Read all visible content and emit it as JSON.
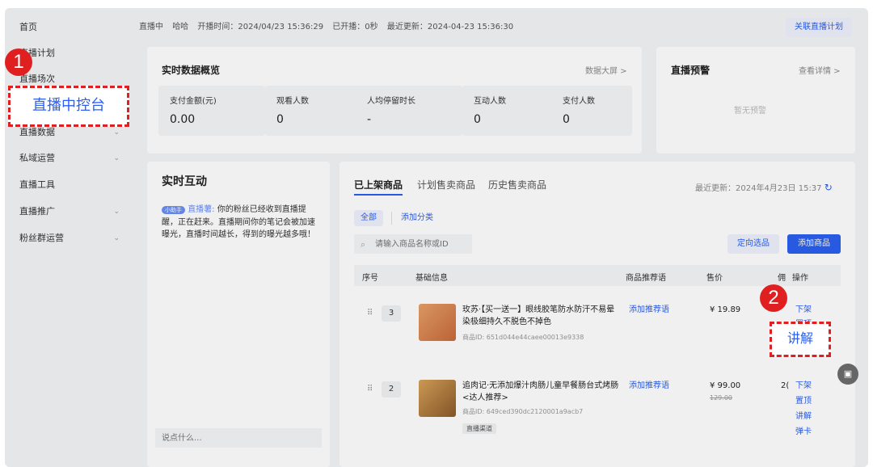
{
  "sidebar": {
    "items": [
      {
        "label": "首页"
      },
      {
        "label": "直播计划"
      },
      {
        "label": "直播场次"
      },
      {
        "label": "直播中控台"
      },
      {
        "label": "直播数据"
      },
      {
        "label": "私域运营"
      },
      {
        "label": "直播工具"
      },
      {
        "label": "直播推广"
      },
      {
        "label": "粉丝群运营"
      }
    ],
    "chevron": "⌄"
  },
  "topbar": {
    "status": "直播中",
    "host": "哈哈",
    "start_time": "开播时间：2024/04/23 15:36:29",
    "duration": "已开播：0秒",
    "updated": "最近更新：2024-04-23 15:36:30",
    "link_plan": "关联直播计划"
  },
  "overview": {
    "title": "实时数据概览",
    "big_screen": "数据大屏 >",
    "metrics": [
      {
        "label": "支付金额(元)",
        "value": "0.00"
      },
      {
        "label": "观看人数",
        "value": "0"
      },
      {
        "label": "人均停留时长",
        "value": "-"
      },
      {
        "label": "互动人数",
        "value": "0"
      },
      {
        "label": "支付人数",
        "value": "0"
      }
    ]
  },
  "warning": {
    "title": "直播预警",
    "details": "查看详情 >",
    "empty": "暂无预警"
  },
  "interaction": {
    "title": "实时互动",
    "badge": "小助手",
    "assistant_name": "直播薯:",
    "message": "你的粉丝已经收到直播提醒，正在赶来。直播期间你的笔记会被加速曝光，直播时间越长，得到的曝光越多哦！",
    "input_placeholder": "说点什么..."
  },
  "products": {
    "tabs": [
      "已上架商品",
      "计划售卖商品",
      "历史售卖商品"
    ],
    "updated": "最近更新：2024年4月23日 15:37",
    "refresh_icon": "↻",
    "filter_all": "全部",
    "add_category": "添加分类",
    "search_placeholder": "请输入商品名称或ID",
    "select_button": "定向选品",
    "add_button": "添加商品",
    "columns": {
      "index": "序号",
      "info": "基础信息",
      "slogan": "商品推荐语",
      "price": "售价",
      "commission": "佣",
      "actions": "操作"
    },
    "rows": [
      {
        "index": "3",
        "title": "玫苏·【买一送一】眼线胶笔防水防汗不易晕染极细持久不脱色不掉色",
        "id": "商品ID: 651d044e44caee00013e9338",
        "slogan": "添加推荐语",
        "price": "¥ 19.89",
        "actions": [
          "下架",
          "置顶"
        ]
      },
      {
        "index": "2",
        "title": "追肉记·无添加爆汁肉肠儿童早餐肠台式烤肠 <达人推荐>",
        "id": "商品ID: 649ced390dc2120001a9acb7",
        "tag": "直播渠道",
        "slogan": "添加推荐语",
        "price": "¥ 99.00",
        "old_price": "129.00",
        "commission": "2(",
        "actions": [
          "下架",
          "置顶",
          "讲解",
          "弹卡"
        ]
      }
    ]
  },
  "annotations": {
    "step1": "1",
    "step2": "2",
    "highlight_explain": "讲解"
  },
  "colors": {
    "accent": "#2b5ff0",
    "annotation": "#e02020"
  }
}
